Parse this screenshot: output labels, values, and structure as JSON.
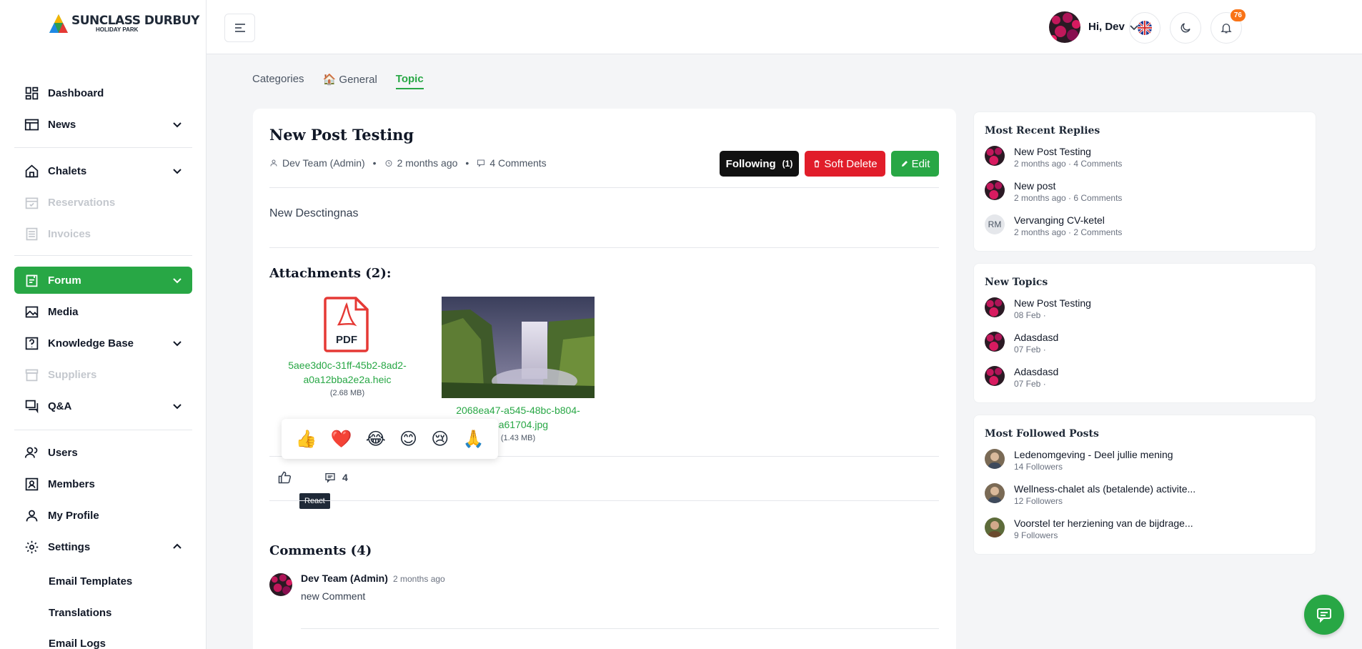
{
  "brand": {
    "line1": "SUNCLASS DURBUY",
    "line2": "HOLIDAY PARK"
  },
  "sidebar": {
    "items": [
      {
        "label": "Dashboard",
        "icon": "dashboard-icon"
      },
      {
        "label": "News",
        "icon": "news-icon"
      },
      {
        "label": "Chalets",
        "icon": "home-icon"
      },
      {
        "label": "Reservations",
        "icon": "calendar-icon"
      },
      {
        "label": "Invoices",
        "icon": "invoice-icon"
      },
      {
        "label": "Forum",
        "icon": "forum-icon"
      },
      {
        "label": "Media",
        "icon": "image-icon"
      },
      {
        "label": "Knowledge Base",
        "icon": "question-icon"
      },
      {
        "label": "Suppliers",
        "icon": "store-icon"
      },
      {
        "label": "Q&A",
        "icon": "chat-icon"
      },
      {
        "label": "Users",
        "icon": "users-icon"
      },
      {
        "label": "Members",
        "icon": "member-icon"
      },
      {
        "label": "My Profile",
        "icon": "profile-icon"
      },
      {
        "label": "Settings",
        "icon": "gear-icon"
      }
    ],
    "settings_sub": [
      "Email Templates",
      "Translations",
      "Email Logs"
    ]
  },
  "header": {
    "notifications_count": "76",
    "greeting": "Hi, Dev"
  },
  "tabs": [
    {
      "label": "Categories"
    },
    {
      "label": "General"
    },
    {
      "label": "Topic"
    }
  ],
  "post": {
    "title": "New Post Testing",
    "author": "Dev Team (Admin)",
    "time": "2 months ago",
    "comments_count": "4 Comments",
    "following_label": "Following",
    "following_count": "(1)",
    "soft_delete_label": "Soft Delete",
    "edit_label": "Edit",
    "description": "New Desctingnas",
    "attachments_title": "Attachments (2):",
    "attachments": [
      {
        "name_line1": "5aee3d0c-31ff-45b2-8ad2-",
        "name_line2": "a0a12bba2e2a.heic",
        "size": "(2.68 MB)",
        "pdf_label": "PDF"
      },
      {
        "name_line1": "2068ea47-a545-48bc-b804-",
        "name_line2": "eca61704.jpg",
        "size": "(1.43 MB)"
      }
    ],
    "reactions": [
      "👍",
      "❤️",
      "😂",
      "😊",
      "😢",
      "🙏"
    ],
    "comment_count_value": "4",
    "react_tooltip": "React",
    "comments_title": "Comments (4)",
    "comments": [
      {
        "author": "Dev Team (Admin)",
        "time": "2 months ago",
        "text": "new Comment"
      }
    ]
  },
  "widgets": {
    "recent_replies": {
      "title": "Most Recent Replies",
      "items": [
        {
          "title": "New Post Testing",
          "sub": "2 months ago · 4 Comments"
        },
        {
          "title": "New post",
          "sub": "2 months ago · 6 Comments"
        },
        {
          "title": "Vervanging CV-ketel",
          "sub": "2 months ago · 2 Comments",
          "initials": "RM"
        }
      ]
    },
    "new_topics": {
      "title": "New Topics",
      "items": [
        {
          "title": "New Post Testing",
          "sub": "08 Feb ·"
        },
        {
          "title": "Adasdasd",
          "sub": "07 Feb ·"
        },
        {
          "title": "Adasdasd",
          "sub": "07 Feb ·"
        }
      ]
    },
    "followed": {
      "title": "Most Followed Posts",
      "items": [
        {
          "title": "Ledenomgeving - Deel jullie mening",
          "sub": "14 Followers"
        },
        {
          "title": "Wellness-chalet als (betalende) activite...",
          "sub": "12 Followers"
        },
        {
          "title": "Voorstel ter herziening van de bijdrage...",
          "sub": "9 Followers"
        }
      ]
    }
  },
  "colors": {
    "accent": "#28a745",
    "danger": "#e11d2a",
    "dark": "#111111",
    "badge": "#f97316"
  }
}
